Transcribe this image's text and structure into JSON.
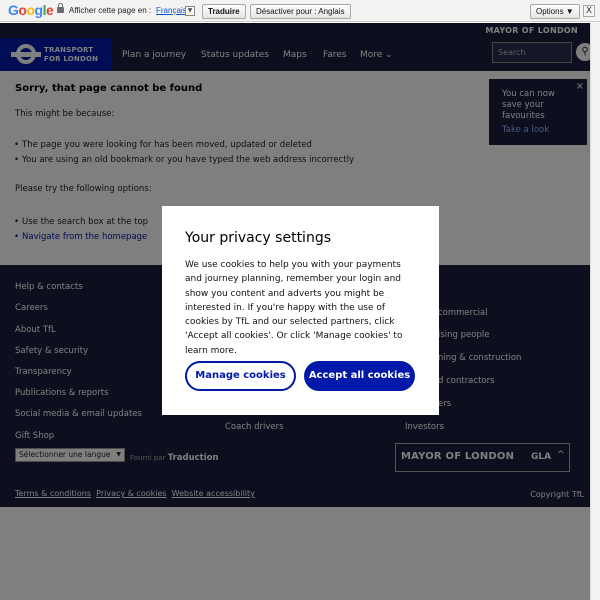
{
  "translate_bar": {
    "logo": "Google",
    "prompt": "Afficher cette page en :",
    "language": "Français",
    "translate_button": "Traduire",
    "disable_button": "Désactiver pour : Anglais",
    "options_button": "Options ▼",
    "close": "X"
  },
  "header": {
    "mayor": "MAYOR OF LONDON",
    "logo_line1": "TRANSPORT",
    "logo_line2": "FOR LONDON",
    "nav": [
      "Plan a journey",
      "Status updates",
      "Maps",
      "Fares",
      "More ⌄"
    ],
    "search_placeholder": "Search"
  },
  "content": {
    "title": "Sorry, that page cannot be found",
    "intro": "This might be because:",
    "reasons": [
      "The page you were looking for has been moved, updated or deleted",
      "You are using an old bookmark or you have typed the web address incorrectly"
    ],
    "options_intro": "Please try the following options:",
    "option_1": "Use the search box at the top",
    "option_2": "Navigate from the homepage"
  },
  "favourites": {
    "text": "You can now save your favourites",
    "link": "Take a look",
    "close": "×"
  },
  "footer": {
    "col1": [
      "Help & contacts",
      "Careers",
      "About TfL",
      "Safety & security",
      "Transparency",
      "Publications & reports",
      "Social media & email updates",
      "Gift Shop"
    ],
    "col2": [
      "Coach drivers"
    ],
    "col3": [
      "commercial",
      "ising people",
      "ning & construction",
      "d contractors",
      "ers",
      "Investors"
    ],
    "language_select": "Sélectionner une langue",
    "powered_by": "Fourni par",
    "translate_brand": "Traduction",
    "mayor_box": "MAYOR OF LONDON",
    "gla": "GLA",
    "bottom_links": [
      "Terms & conditions",
      "Privacy & cookies",
      "Website accessibility"
    ],
    "copyright": "Copyright TfL"
  },
  "modal": {
    "title": "Your privacy settings",
    "body": "We use cookies to help you with your payments and journey planning, remember your login and show you content and adverts you might be interested in. If you're happy with the use of cookies by TfL and our selected partners, click 'Accept all cookies'. Or click 'Manage cookies' to learn more.",
    "manage_label": "Manage cookies",
    "accept_label": "Accept all cookies"
  },
  "colors": {
    "tfl_navy": "#1d1e3d",
    "tfl_blue": "#0019a8"
  }
}
